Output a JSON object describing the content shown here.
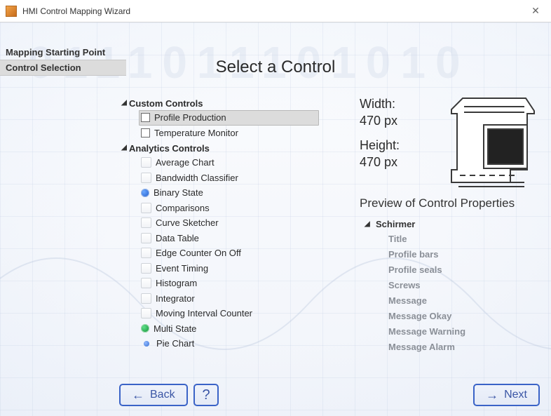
{
  "window": {
    "title": "HMI Control Mapping Wizard"
  },
  "steps": {
    "mapping": "Mapping Starting Point",
    "selection": "Control Selection"
  },
  "heading": "Select a Control",
  "tree": {
    "group_custom": "Custom Controls",
    "group_analytics": "Analytics Controls",
    "custom": {
      "profile_production": "Profile Production",
      "temperature_monitor": "Temperature Monitor"
    },
    "analytics": {
      "average_chart": "Average Chart",
      "bandwidth_classifier": "Bandwidth Classifier",
      "binary_state": "Binary State",
      "comparisons": "Comparisons",
      "curve_sketcher": "Curve Sketcher",
      "data_table": "Data Table",
      "edge_counter": "Edge Counter On Off",
      "event_timing": "Event Timing",
      "histogram": "Histogram",
      "integrator": "Integrator",
      "moving_interval": "Moving Interval Counter",
      "multi_state": "Multi State",
      "pie_chart": "Pie Chart"
    }
  },
  "dims": {
    "width_label": "Width:",
    "width_value": "470 px",
    "height_label": "Height:",
    "height_value": "470 px"
  },
  "props": {
    "heading": "Preview of Control Properties",
    "root": "Schirmer",
    "items": {
      "title": "Title",
      "profile_bars": "Profile bars",
      "profile_seals": "Profile seals",
      "screws": "Screws",
      "message": "Message",
      "message_okay": "Message Okay",
      "message_warning": "Message Warning",
      "message_alarm": "Message Alarm"
    }
  },
  "buttons": {
    "back": "Back",
    "help": "?",
    "next": "Next"
  },
  "bg_digits": "0111011101010"
}
